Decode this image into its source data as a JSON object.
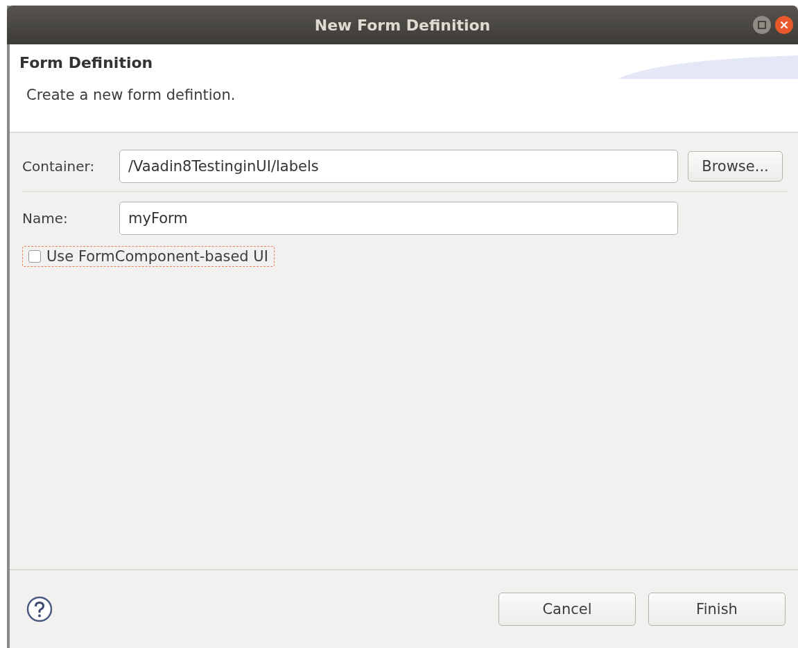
{
  "window": {
    "title": "New Form Definition"
  },
  "header": {
    "title": "Form Definition",
    "description": "Create a new form defintion."
  },
  "container": {
    "label": "Container:",
    "value": "/Vaadin8TestinginUI/labels",
    "button": "Browse..."
  },
  "name": {
    "label": "Name:",
    "value": "myForm"
  },
  "checkbox": {
    "label": "Use FormComponent-based UI",
    "checked": false,
    "focused": true
  },
  "buttons": [
    "Cancel",
    "Finish"
  ]
}
